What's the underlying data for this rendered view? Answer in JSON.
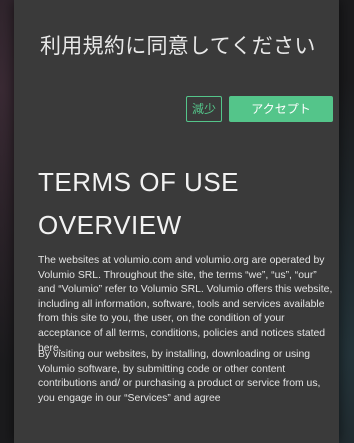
{
  "dialog": {
    "title": "利用規約に同意してください",
    "decline_label": "減少",
    "accept_label": "アクセプト",
    "accent_color": "#54c58a"
  },
  "terms": {
    "heading": "TERMS OF USE",
    "subheading": "OVERVIEW",
    "paragraphs": [
      "The websites at volumio.com and volumio.org are operated by Volumio SRL. Throughout the site, the terms “we”, “us”, “our” and “Volumio” refer to Volumio SRL. Volumio offers this website, including all information, software, tools and services available from this site to you, the user, on the condition of your acceptance of all terms, conditions, policies and notices stated here.",
      "By visiting our websites, by installing, downloading or using Volumio software, by submitting code or other content contributions and/ or purchasing a product or service from us, you engage in our “Services” and agree"
    ]
  }
}
